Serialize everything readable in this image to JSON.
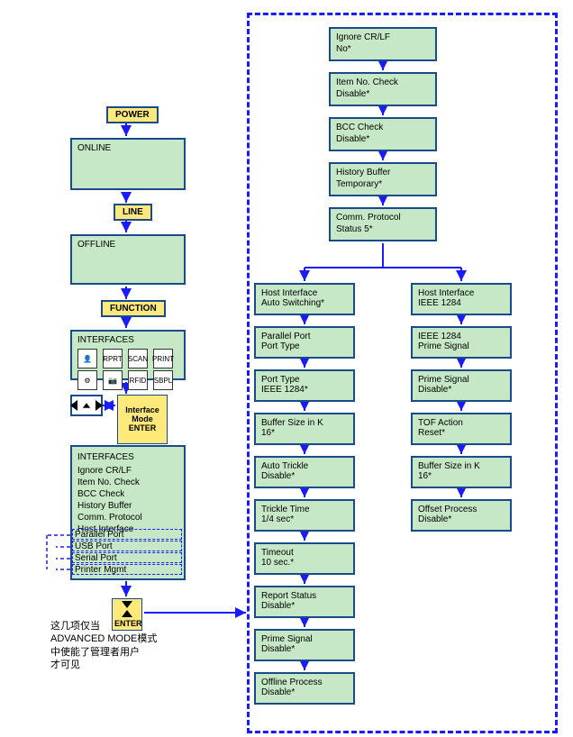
{
  "tags": {
    "power": "POWER",
    "line": "LINE",
    "function": "FUNCTION",
    "interface_mode": "Interface\nMode",
    "enter1": "ENTER",
    "enter2": "ENTER"
  },
  "left": {
    "online": "ONLINE",
    "offline": "OFFLINE",
    "interfaces_title": "INTERFACES",
    "interfaces2_title": "INTERFACES",
    "items": [
      "Ignore CR/LF",
      "Item No. Check",
      "BCC Check",
      "History Buffer",
      "Comm. Protocol",
      "Host Interface",
      "Parallel Port",
      "USB Port",
      "Serial Port",
      "Printer Mgmt"
    ]
  },
  "annotation": {
    "l1": "这几项仅当",
    "l2": "ADVANCED MODE模式",
    "l3": "中使能了管理者用户",
    "l4": "才可见"
  },
  "right_top": [
    {
      "t": "Ignore CR/LF",
      "v": "No*"
    },
    {
      "t": "Item No. Check",
      "v": "Disable*"
    },
    {
      "t": "BCC Check",
      "v": "Disable*"
    },
    {
      "t": "History Buffer",
      "v": "Temporary*"
    },
    {
      "t": "Comm. Protocol",
      "v": "Status 5*"
    }
  ],
  "colA": [
    {
      "t": "Host Interface",
      "v": "Auto Switching*"
    },
    {
      "t": "Parallel Port",
      "v": "Port Type"
    },
    {
      "t": "Port Type",
      "v": "IEEE 1284*"
    },
    {
      "t": "Buffer Size in K",
      "v": "16*"
    },
    {
      "t": "Auto Trickle",
      "v": "Disable*"
    },
    {
      "t": "Trickle Time",
      "v": "1/4 sec*"
    },
    {
      "t": "Timeout",
      "v": "10 sec.*"
    },
    {
      "t": "Report Status",
      "v": "Disable*"
    },
    {
      "t": "Prime Signal",
      "v": "Disable*"
    },
    {
      "t": "Offline Process",
      "v": "Disable*"
    }
  ],
  "colB": [
    {
      "t": "Host Interface",
      "v": "IEEE 1284"
    },
    {
      "t": "IEEE 1284",
      "v": "Prime Signal"
    },
    {
      "t": "Prime Signal",
      "v": "Disable*"
    },
    {
      "t": "TOF Action",
      "v": "Reset*"
    },
    {
      "t": "Buffer Size in K",
      "v": "16*"
    },
    {
      "t": "Offset Process",
      "v": "Disable*"
    }
  ],
  "icons": {
    "i1": "👤",
    "i2": "RPRT",
    "i3": "SCAN",
    "i4": "RFID",
    "i5": "PRINT",
    "i6": "⚙",
    "i7": "📷",
    "i8": "SBPL"
  }
}
